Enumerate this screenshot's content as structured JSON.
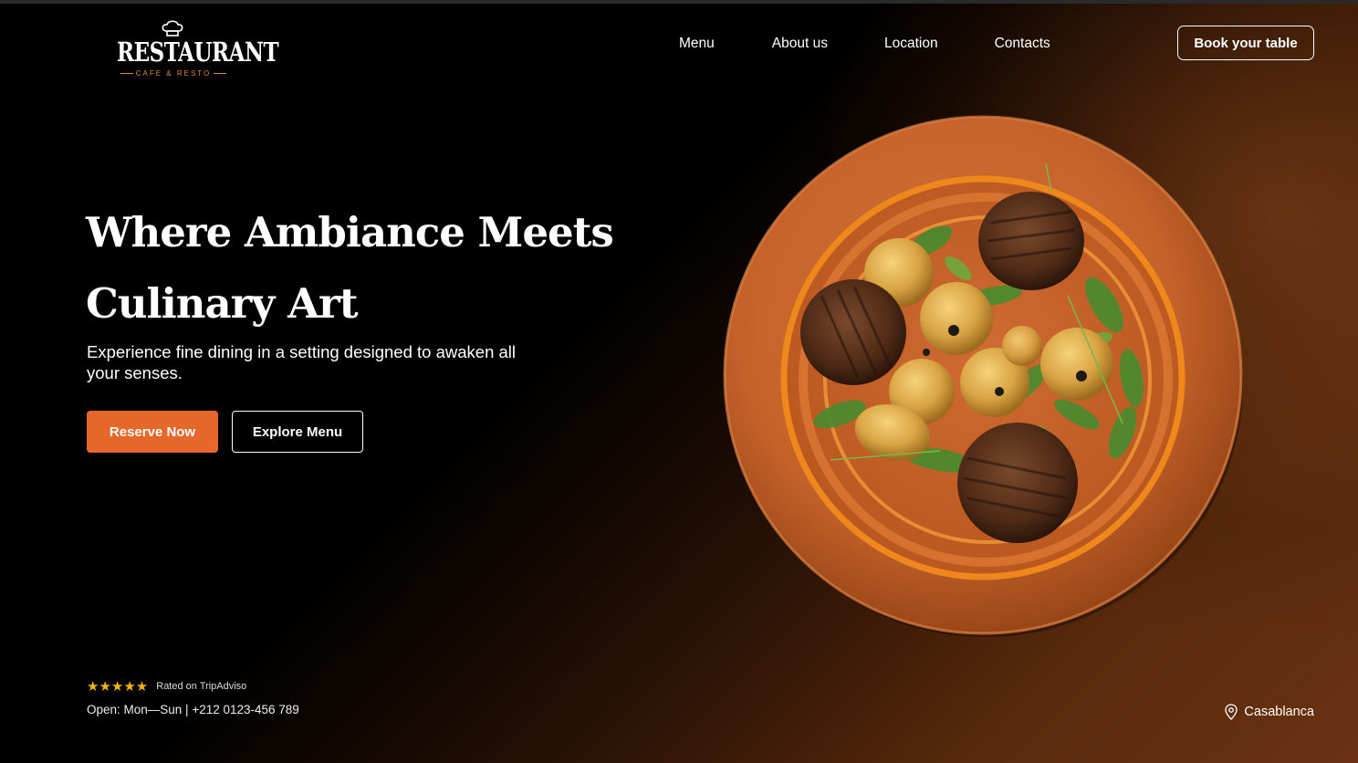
{
  "logo": {
    "brand": "RESTAURANT",
    "tagline": "CAFE & RESTO",
    "icon": "chef-hat-icon"
  },
  "nav": {
    "items": [
      "Menu",
      "About us",
      "Location",
      "Contacts"
    ],
    "book_label": "Book your table"
  },
  "hero": {
    "title_line1": "Where Ambiance Meets",
    "title_line2": "Culinary Art",
    "subtitle": "Experience fine dining in a setting designed to awaken all your senses.",
    "reserve_label": "Reserve Now",
    "explore_label": "Explore Menu"
  },
  "footer": {
    "stars": "★★★★★",
    "rating_text": "Rated on TripAdviso",
    "hours": "Open: Mon—Sun | +212 0123-456 789",
    "location": "Casablanca",
    "location_icon": "map-pin-icon"
  },
  "colors": {
    "accent": "#e6672a",
    "star": "#f5b400",
    "background": "#000000",
    "plate": "#c9682e"
  }
}
